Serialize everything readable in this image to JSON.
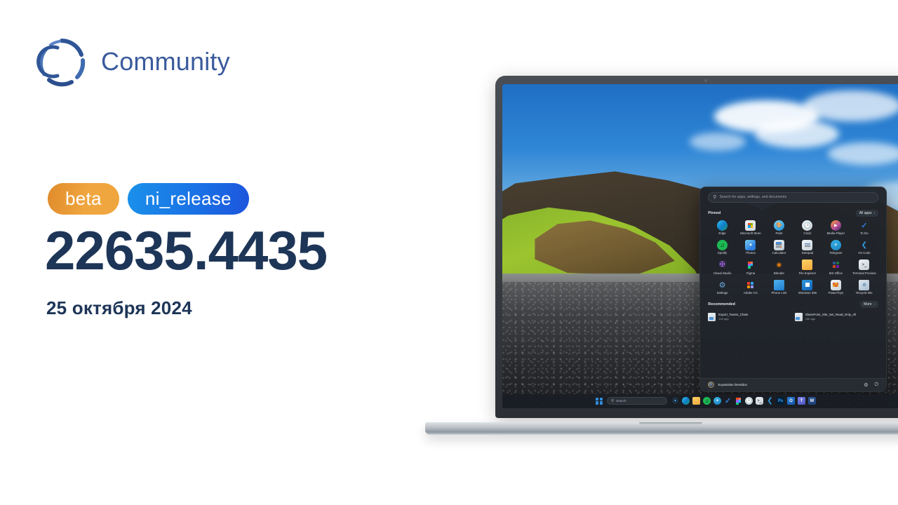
{
  "brand": {
    "name": "Community",
    "logo_icon": "community-c-logo",
    "color": "#3a5a9c"
  },
  "release": {
    "badges": [
      {
        "label": "beta",
        "color": "#e8993a"
      },
      {
        "label": "ni_release",
        "color": "#1a72e6"
      }
    ],
    "build_number": "22635.4435",
    "date": "25 октября 2024",
    "text_color": "#1d3557"
  },
  "device": {
    "type": "laptop",
    "bezel_color": "#3c4046",
    "base_color": "#b9bfc5"
  },
  "wallpaper": {
    "description": "Iceland black sand beach with mossy green cliff, sea stacks and blue sky"
  },
  "start_menu": {
    "search": {
      "placeholder": "Search for apps, settings, and documents",
      "icon": "search-icon"
    },
    "pinned": {
      "title": "Pinned",
      "all_apps_label": "All apps",
      "all_apps_chevron": "›",
      "apps": [
        {
          "label": "Edge",
          "icon": "edge-icon"
        },
        {
          "label": "Microsoft Store",
          "icon": "microsoft-store-icon"
        },
        {
          "label": "Paint",
          "icon": "paint-icon"
        },
        {
          "label": "Clock",
          "icon": "clock-icon"
        },
        {
          "label": "Media Player",
          "icon": "media-player-icon"
        },
        {
          "label": "To Do",
          "icon": "to-do-icon"
        },
        {
          "label": "Spotify",
          "icon": "spotify-icon"
        },
        {
          "label": "Photos",
          "icon": "photos-icon"
        },
        {
          "label": "Calculator",
          "icon": "calculator-icon"
        },
        {
          "label": "Notepad",
          "icon": "notepad-icon"
        },
        {
          "label": "Telegram",
          "icon": "telegram-icon"
        },
        {
          "label": "VS Code",
          "icon": "vs-code-icon"
        },
        {
          "label": "Visual Studio",
          "icon": "visual-studio-icon"
        },
        {
          "label": "Figma",
          "icon": "figma-icon"
        },
        {
          "label": "Blender",
          "icon": "blender-icon"
        },
        {
          "label": "File Explorer",
          "icon": "file-explorer-icon"
        },
        {
          "label": "MS Office",
          "icon": "ms-office-icon"
        },
        {
          "label": "Terminal Preview",
          "icon": "terminal-icon"
        },
        {
          "label": "Settings",
          "icon": "settings-gear-icon"
        },
        {
          "label": "Adobe CC",
          "icon": "adobe-cc-icon"
        },
        {
          "label": "Phone Link",
          "icon": "phone-link-icon"
        },
        {
          "label": "Windows 365",
          "icon": "windows-365-icon"
        },
        {
          "label": "PowerToys",
          "icon": "powertoys-icon"
        },
        {
          "label": "Recycle Bin",
          "icon": "recycle-bin-icon"
        }
      ]
    },
    "recommended": {
      "title": "Recommended",
      "more_label": "More",
      "more_chevron": "›",
      "items": [
        {
          "name": "Export_Teams_Chats",
          "time": "14h ago",
          "icon": "pdf-document-icon"
        },
        {
          "name": "SharePoint_Site_Set_Read_Only_All",
          "time": "15h ago",
          "icon": "pdf-document-icon"
        }
      ]
    },
    "account": {
      "user_name": "Svyatoslav Demidov",
      "avatar_icon": "user-avatar",
      "settings_icon": "⚙",
      "power_icon": "⏻"
    }
  },
  "taskbar": {
    "start_icon": "windows-start-icon",
    "search": {
      "placeholder": "Search",
      "icon": "search-icon"
    },
    "items": [
      {
        "label": "Copilot",
        "icon": "copilot-icon"
      },
      {
        "label": "Edge",
        "icon": "edge-icon"
      },
      {
        "label": "File Explorer",
        "icon": "file-explorer-icon"
      },
      {
        "label": "Spotify",
        "icon": "spotify-icon"
      },
      {
        "label": "Telegram",
        "icon": "telegram-icon"
      },
      {
        "label": "To Do",
        "icon": "to-do-icon"
      },
      {
        "label": "Figma",
        "icon": "figma-icon"
      },
      {
        "label": "Clock",
        "icon": "clock-icon"
      },
      {
        "label": "Terminal",
        "icon": "terminal-icon"
      },
      {
        "label": "VS Code",
        "icon": "vs-code-icon"
      },
      {
        "label": "Photoshop",
        "icon": "photoshop-icon"
      },
      {
        "label": "Outlook",
        "icon": "outlook-icon"
      },
      {
        "label": "Teams",
        "icon": "teams-icon"
      },
      {
        "label": "Word",
        "icon": "word-icon"
      }
    ]
  }
}
